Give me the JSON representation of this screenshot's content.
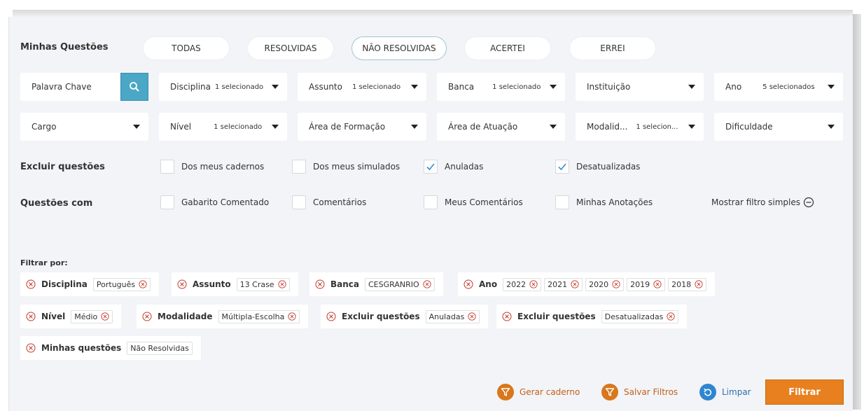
{
  "minhas": {
    "title": "Minhas Questões",
    "pills": [
      "TODAS",
      "RESOLVIDAS",
      "NÃO RESOLVIDAS",
      "ACERTEI",
      "ERREI"
    ]
  },
  "search": {
    "placeholder": "Palavra Chave"
  },
  "filters_row1": [
    {
      "label": "Disciplina",
      "selected": "1 selecionado"
    },
    {
      "label": "Assunto",
      "selected": "1 selecionado"
    },
    {
      "label": "Banca",
      "selected": "1 selecionado"
    },
    {
      "label": "Instituição",
      "selected": ""
    },
    {
      "label": "Ano",
      "selected": "5 selecionados"
    }
  ],
  "filters_row2": [
    {
      "label": "Cargo",
      "selected": ""
    },
    {
      "label": "Nível",
      "selected": "1 selecionado"
    },
    {
      "label": "Área de Formação",
      "selected": ""
    },
    {
      "label": "Área de Atuação",
      "selected": ""
    },
    {
      "label": "Modalid...",
      "selected": "1 selecion..."
    },
    {
      "label": "Dificuldade",
      "selected": ""
    }
  ],
  "excluir": {
    "title": "Excluir questões",
    "options": [
      {
        "label": "Dos meus cadernos",
        "checked": false
      },
      {
        "label": "Dos meus simulados",
        "checked": false
      },
      {
        "label": "Anuladas",
        "checked": true
      },
      {
        "label": "Desatualizadas",
        "checked": true
      }
    ]
  },
  "questoes_com": {
    "title": "Questões com",
    "options": [
      {
        "label": "Gabarito Comentado",
        "checked": false
      },
      {
        "label": "Comentários",
        "checked": false
      },
      {
        "label": "Meus Comentários",
        "checked": false
      },
      {
        "label": "Minhas Anotações",
        "checked": false
      }
    ],
    "toggle_label": "Mostrar filtro simples"
  },
  "filtrar_por": {
    "title": "Filtrar por:",
    "chips": [
      {
        "key": "Disciplina",
        "values": [
          "Português"
        ]
      },
      {
        "key": "Assunto",
        "values": [
          "13 Crase"
        ]
      },
      {
        "key": "Banca",
        "values": [
          "CESGRANRIO"
        ]
      },
      {
        "key": "Ano",
        "values": [
          "2022",
          "2021",
          "2020",
          "2019",
          "2018"
        ]
      },
      {
        "key": "Nível",
        "values": [
          "Médio"
        ]
      },
      {
        "key": "Modalidade",
        "values": [
          "Múltipla-Escolha"
        ]
      },
      {
        "key": "Excluir questões",
        "values": [
          "Anuladas"
        ]
      },
      {
        "key": "Excluir questões",
        "values": [
          "Desatualizadas"
        ]
      },
      {
        "key": "Minhas questões",
        "values": [
          "Não Resolvidas"
        ]
      }
    ]
  },
  "actions": {
    "gerar": "Gerar caderno",
    "salvar": "Salvar Filtros",
    "limpar": "Limpar",
    "filtrar": "Filtrar"
  },
  "colors": {
    "accent_orange": "#e8801f",
    "search_blue": "#4ba7c6",
    "chip_x_red": "#c0392b",
    "check_blue": "#3a8fd0"
  }
}
